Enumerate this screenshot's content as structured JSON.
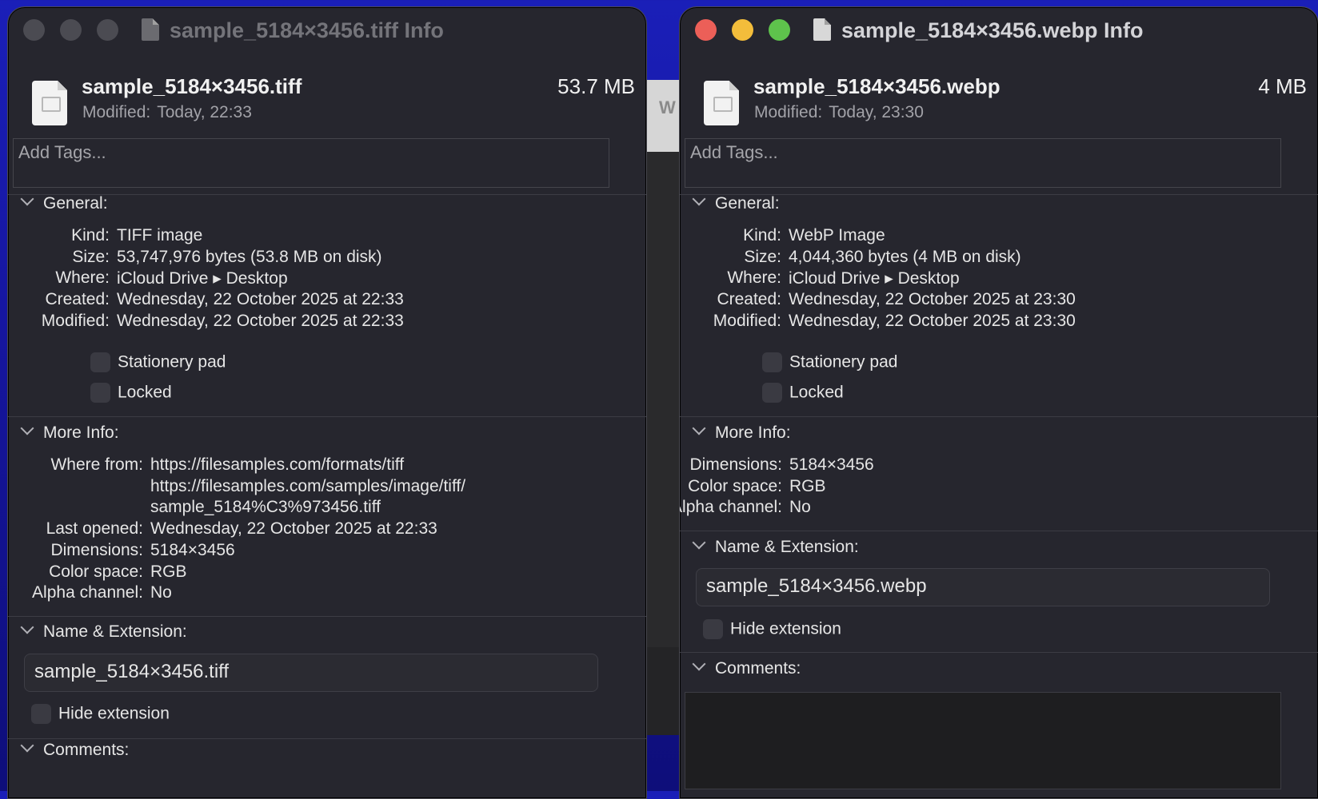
{
  "background_window": {
    "partial_label": "W"
  },
  "left": {
    "title": "sample_5184×3456.tiff Info",
    "file_name": "sample_5184×3456.tiff",
    "file_size": "53.7 MB",
    "modified_label": "Modified:",
    "modified_value": "Today, 22:33",
    "tags_placeholder": "Add Tags...",
    "general_label": "General:",
    "general": [
      {
        "k": "Kind:",
        "v": "TIFF image"
      },
      {
        "k": "Size:",
        "v": "53,747,976 bytes (53.8 MB on disk)"
      },
      {
        "k": "Where:",
        "v": "iCloud Drive ▸ Desktop"
      },
      {
        "k": "Created:",
        "v": "Wednesday, 22 October 2025 at 22:33"
      },
      {
        "k": "Modified:",
        "v": "Wednesday, 22 October 2025 at 22:33"
      }
    ],
    "stationery_label": "Stationery pad",
    "locked_label": "Locked",
    "more_info_label": "More Info:",
    "more_info": [
      {
        "k": "Where from:",
        "v": "https://filesamples.com/formats/tiff"
      },
      {
        "k": "",
        "v": "https://filesamples.com/samples/image/tiff/"
      },
      {
        "k": "",
        "v": "sample_5184%C3%973456.tiff"
      },
      {
        "k": "Last opened:",
        "v": "Wednesday, 22 October 2025 at 22:33"
      },
      {
        "k": "Dimensions:",
        "v": "5184×3456"
      },
      {
        "k": "Color space:",
        "v": "RGB"
      },
      {
        "k": "Alpha channel:",
        "v": "No"
      }
    ],
    "name_ext_label": "Name & Extension:",
    "name_value": "sample_5184×3456.tiff",
    "hide_ext_label": "Hide extension",
    "comments_label": "Comments:"
  },
  "right": {
    "title": "sample_5184×3456.webp Info",
    "file_name": "sample_5184×3456.webp",
    "file_size": "4 MB",
    "modified_label": "Modified:",
    "modified_value": "Today, 23:30",
    "tags_placeholder": "Add Tags...",
    "general_label": "General:",
    "general": [
      {
        "k": "Kind:",
        "v": "WebP Image"
      },
      {
        "k": "Size:",
        "v": "4,044,360 bytes (4 MB on disk)"
      },
      {
        "k": "Where:",
        "v": "iCloud Drive ▸ Desktop"
      },
      {
        "k": "Created:",
        "v": "Wednesday, 22 October 2025 at 23:30"
      },
      {
        "k": "Modified:",
        "v": "Wednesday, 22 October 2025 at 23:30"
      }
    ],
    "stationery_label": "Stationery pad",
    "locked_label": "Locked",
    "more_info_label": "More Info:",
    "more_info": [
      {
        "k": "Dimensions:",
        "v": "5184×3456"
      },
      {
        "k": "Color space:",
        "v": "RGB"
      },
      {
        "k": "Alpha channel:",
        "v": "No"
      }
    ],
    "name_ext_label": "Name & Extension:",
    "name_value": "sample_5184×3456.webp",
    "hide_ext_label": "Hide extension",
    "comments_label": "Comments:"
  },
  "colors": {
    "close": "#ec5f58",
    "minimize": "#f3bd3b",
    "zoom": "#5ec24c",
    "window_bg": "#26262e",
    "desktop": "#1a1fb8"
  }
}
